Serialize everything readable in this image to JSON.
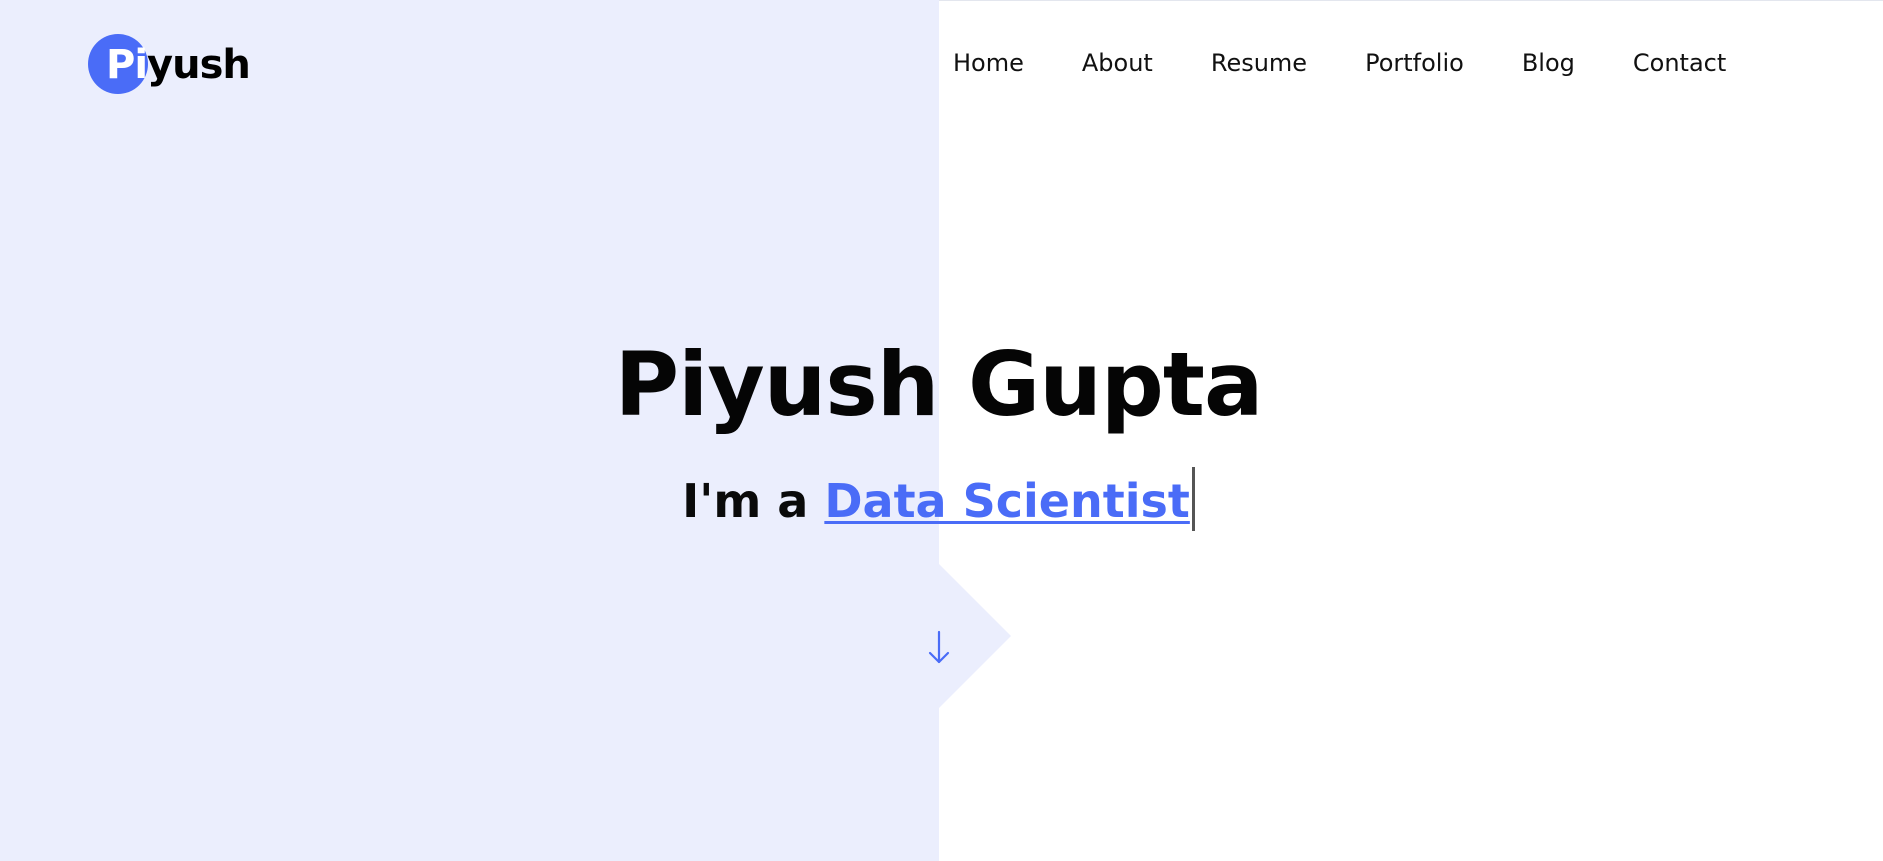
{
  "logo": {
    "highlight": "Pi",
    "rest": "yush"
  },
  "nav": {
    "items": [
      "Home",
      "About",
      "Resume",
      "Portfolio",
      "Blog",
      "Contact"
    ]
  },
  "hero": {
    "name": "Piyush Gupta",
    "intro": "I'm a",
    "role": "Data Scientist"
  },
  "icons": {
    "scroll": "arrow-down-icon"
  },
  "colors": {
    "accent": "#4a6cf7",
    "panel": "#ebeefd",
    "text": "#000000",
    "background": "#ffffff"
  }
}
